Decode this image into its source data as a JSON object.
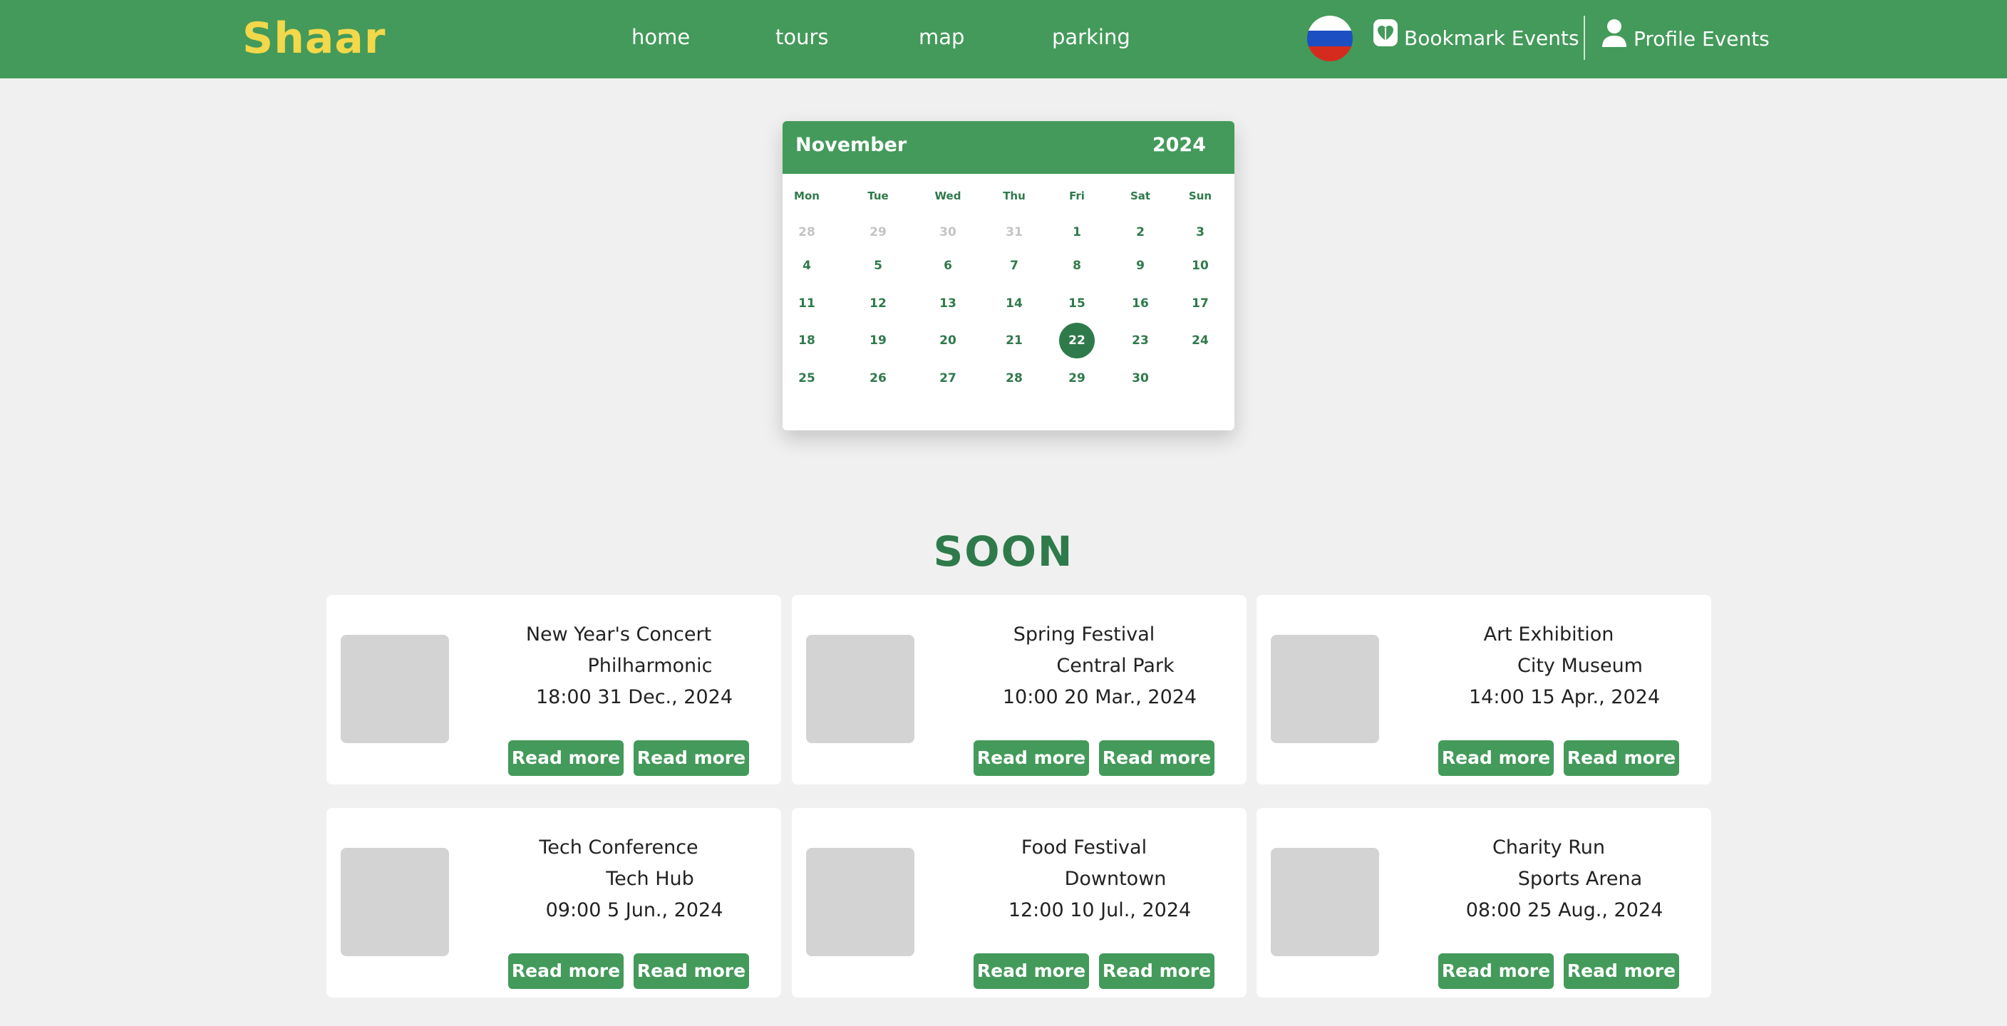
{
  "header": {
    "logo": "Shaar",
    "nav": [
      "home",
      "tours",
      "map",
      "parking"
    ],
    "language_icon": "russia-flag-icon",
    "bookmark_label": "Bookmark Events",
    "profile_label": "Profile Events"
  },
  "calendar": {
    "month": "November",
    "year": "2024",
    "weekdays": [
      "Mon",
      "Tue",
      "Wed",
      "Thu",
      "Fri",
      "Sat",
      "Sun"
    ],
    "weeks": [
      [
        "28",
        "29",
        "30",
        "31",
        "1",
        "2",
        "3"
      ],
      [
        "4",
        "5",
        "6",
        "7",
        "8",
        "9",
        "10"
      ],
      [
        "11",
        "12",
        "13",
        "14",
        "15",
        "16",
        "17"
      ],
      [
        "18",
        "19",
        "20",
        "21",
        "22",
        "23",
        "24"
      ],
      [
        "25",
        "26",
        "27",
        "28",
        "29",
        "30",
        ""
      ]
    ],
    "muted_days": [
      "28",
      "29",
      "30",
      "31"
    ],
    "selected_day": "22"
  },
  "soon": {
    "title": "SOON",
    "events": [
      {
        "name": "New Year's Concert",
        "place": "Philharmonic",
        "time": "18:00 31 Dec., 2024",
        "button1": "Read more",
        "button2": "Read more"
      },
      {
        "name": "Spring Festival",
        "place": "Central Park",
        "time": "10:00 20 Mar., 2024",
        "button1": "Read more",
        "button2": "Read more"
      },
      {
        "name": "Art Exhibition",
        "place": "City Museum",
        "time": "14:00 15 Apr., 2024",
        "button1": "Read more",
        "button2": "Read more"
      },
      {
        "name": "Tech Conference",
        "place": "Tech Hub",
        "time": "09:00 5 Jun., 2024",
        "button1": "Read more",
        "button2": "Read more"
      },
      {
        "name": "Food Festival",
        "place": "Downtown",
        "time": "12:00 10 Jul., 2024",
        "button1": "Read more",
        "button2": "Read more"
      },
      {
        "name": "Charity Run",
        "place": "Sports Arena",
        "time": "08:00 25 Aug., 2024",
        "button1": "Read more",
        "button2": "Read more"
      }
    ]
  },
  "colors": {
    "brand_green": "#439a5a",
    "dark_green": "#2f7a4b",
    "logo_yellow": "#f2d84a",
    "page_background": "#f0f0f0"
  }
}
